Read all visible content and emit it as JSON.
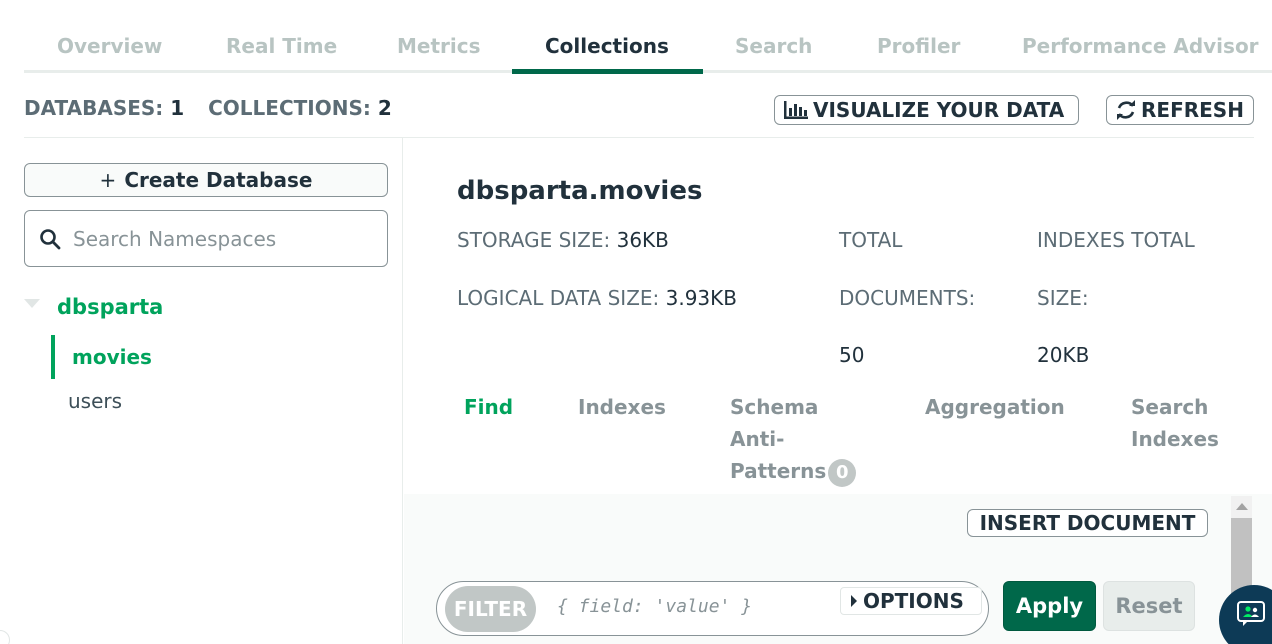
{
  "tabs": [
    {
      "label": "Overview"
    },
    {
      "label": "Real Time"
    },
    {
      "label": "Metrics"
    },
    {
      "label": "Collections",
      "active": true
    },
    {
      "label": "Search"
    },
    {
      "label": "Profiler"
    },
    {
      "label": "Performance Advisor"
    }
  ],
  "summary": {
    "databases_label": "DATABASES:",
    "databases_count": "1",
    "collections_label": "COLLECTIONS:",
    "collections_count": "2",
    "visualize_label": "VISUALIZE YOUR DATA",
    "refresh_label": "REFRESH"
  },
  "sidebar": {
    "create_db_label": "Create Database",
    "create_db_plus": "+",
    "search_placeholder": "Search Namespaces",
    "database": "dbsparta",
    "collections": [
      {
        "name": "movies",
        "active": true
      },
      {
        "name": "users",
        "active": false
      }
    ]
  },
  "main": {
    "namespace": "dbsparta.movies",
    "stats": {
      "storage_size_label": "STORAGE SIZE:",
      "storage_size_value": "36KB",
      "logical_size_label": "LOGICAL DATA SIZE:",
      "logical_size_value": "3.93KB",
      "total_docs_label_1": "TOTAL",
      "total_docs_label_2": "DOCUMENTS:",
      "total_docs_value": "50",
      "indexes_label_1": "INDEXES TOTAL",
      "indexes_label_2": "SIZE:",
      "indexes_value": "20KB"
    },
    "sub_tabs": {
      "find": "Find",
      "indexes": "Indexes",
      "schema_1": "Schema",
      "schema_2": "Anti-",
      "schema_3": "Patterns",
      "schema_badge": "0",
      "aggregation": "Aggregation",
      "search_1": "Search",
      "search_2": "Indexes"
    },
    "insert_document_label": "INSERT DOCUMENT",
    "filter": {
      "pill_label": "FILTER",
      "placeholder": "{ field: 'value' }",
      "options_label": "OPTIONS",
      "apply_label": "Apply",
      "reset_label": "Reset"
    }
  },
  "colors": {
    "accent_green": "#00a35c",
    "dark_green": "#00684a",
    "text_dark": "#21313c",
    "muted": "#889397"
  },
  "icons": [
    "chart-bars-icon",
    "refresh-icon",
    "search-icon",
    "caret-down-icon",
    "caret-right-icon",
    "chat-assistant-icon"
  ]
}
